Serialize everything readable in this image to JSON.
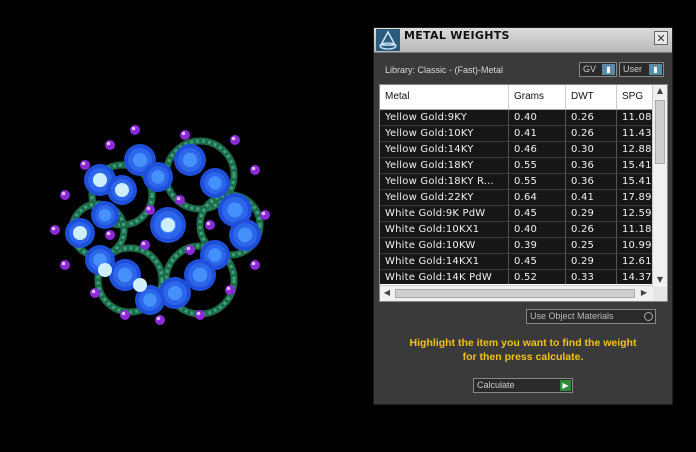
{
  "window": {
    "title": "METAL WEIGHTS",
    "close_glyph": "✕"
  },
  "library": {
    "label": "Library: Classic - (Fast)-Metal"
  },
  "dropdowns": {
    "gv": {
      "value": "GV"
    },
    "user": {
      "value": "User"
    }
  },
  "table": {
    "headers": [
      "Metal",
      "Grams",
      "DWT",
      "SPG"
    ],
    "rows": [
      {
        "metal": "Yellow Gold:9KY",
        "grams": "0.40",
        "dwt": "0.26",
        "spg": "11.08"
      },
      {
        "metal": "Yellow Gold:10KY",
        "grams": "0.41",
        "dwt": "0.26",
        "spg": "11.43"
      },
      {
        "metal": "Yellow Gold:14KY",
        "grams": "0.46",
        "dwt": "0.30",
        "spg": "12.88"
      },
      {
        "metal": "Yellow Gold:18KY",
        "grams": "0.55",
        "dwt": "0.36",
        "spg": "15.41"
      },
      {
        "metal": "Yellow Gold:18KY R...",
        "grams": "0.55",
        "dwt": "0.36",
        "spg": "15.41"
      },
      {
        "metal": "Yellow Gold:22KY",
        "grams": "0.64",
        "dwt": "0.41",
        "spg": "17.89"
      },
      {
        "metal": "White Gold:9K PdW",
        "grams": "0.45",
        "dwt": "0.29",
        "spg": "12.59"
      },
      {
        "metal": "White Gold:10KX1",
        "grams": "0.40",
        "dwt": "0.26",
        "spg": "11.18"
      },
      {
        "metal": "White Gold:10KW",
        "grams": "0.39",
        "dwt": "0.25",
        "spg": "10.99"
      },
      {
        "metal": "White Gold:14KX1",
        "grams": "0.45",
        "dwt": "0.29",
        "spg": "12.61"
      },
      {
        "metal": "White Gold:14K PdW",
        "grams": "0.52",
        "dwt": "0.33",
        "spg": "14.37"
      }
    ]
  },
  "options": {
    "use_object_materials": "Use Object Materials"
  },
  "hint": {
    "line1": "Highlight the item you want to find the weight",
    "line2": "for then press calculate."
  },
  "calculate": {
    "label": "Calculate"
  },
  "colors": {
    "hint_text": "#f2c21a",
    "panel_bg": "#3a3a3a",
    "row_bg": "#161616"
  }
}
